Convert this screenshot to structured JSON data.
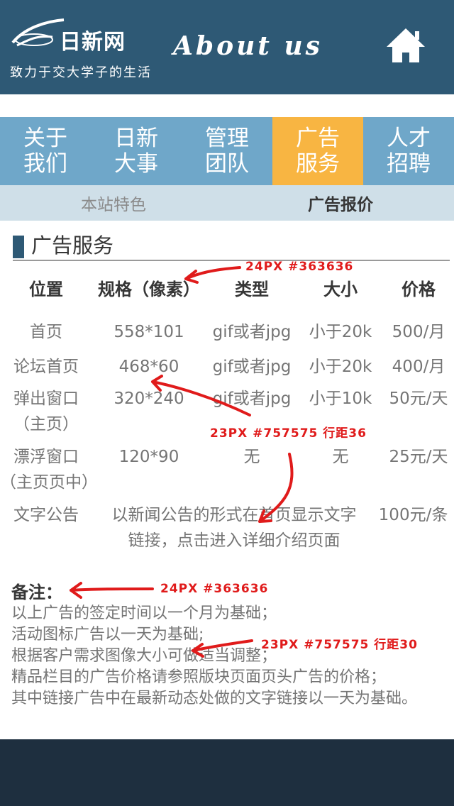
{
  "header": {
    "logo_text": "日新网",
    "slogan": "致力于交大学子的生活",
    "title": "About us"
  },
  "nav": {
    "items": [
      {
        "label": "关于\n我们"
      },
      {
        "label": "日新\n大事"
      },
      {
        "label": "管理\n团队"
      },
      {
        "label": "广告\n服务"
      },
      {
        "label": "人才\n招聘"
      }
    ]
  },
  "subnav": {
    "items": [
      {
        "label": "本站特色"
      },
      {
        "label": "广告报价"
      }
    ]
  },
  "section": {
    "title": "广告服务"
  },
  "table": {
    "headers": [
      "位置",
      "规格（像素）",
      "类型",
      "大小",
      "价格"
    ],
    "rows": [
      {
        "position": "首页",
        "size_px": "558*101",
        "type": "gif或者jpg",
        "filesize": "小于20k",
        "price": "500/月"
      },
      {
        "position": "论坛首页",
        "size_px": "468*60",
        "type": "gif或者jpg",
        "filesize": "小于20k",
        "price": "400/月"
      },
      {
        "position": "弹出窗口",
        "position_sub": "（主页）",
        "size_px": "320*240",
        "type": "gif或者jpg",
        "filesize": "小于10k",
        "price": "50元/天"
      },
      {
        "position": "漂浮窗口",
        "position_sub": "（主页页中）",
        "size_px": "120*90",
        "type": "无",
        "filesize": "无",
        "price": "25元/天"
      },
      {
        "position": "文字公告",
        "desc_line1": "以新闻公告的形式在首页显示文字",
        "desc_line2": "链接，点击进入详细介绍页面",
        "price": "100元/条"
      }
    ]
  },
  "notes": {
    "title": "备注：",
    "lines": [
      "以上广告的签定时间以一个月为基础；",
      "活动图标广告以一天为基础;",
      "根据客户需求图像大小可做适当调整；",
      "精品栏目的广告价格请参照版块页面页头广告的价格；",
      "其中链接广告中在最新动态处做的文字链接以一天为基础。"
    ]
  },
  "annotations": {
    "header_spec": "24PX  #363636",
    "body_spec": "23PX  #757575  行距36",
    "notes_title_spec": "24PX  #363636",
    "notes_body_spec": "23PX  #757575  行距30"
  },
  "colors": {
    "header_bg": "#2e5975",
    "nav_bg": "#6fa7c9",
    "nav_active": "#f8b542",
    "subnav_bg": "#cfdfe8",
    "annotation": "#e01b1b"
  }
}
